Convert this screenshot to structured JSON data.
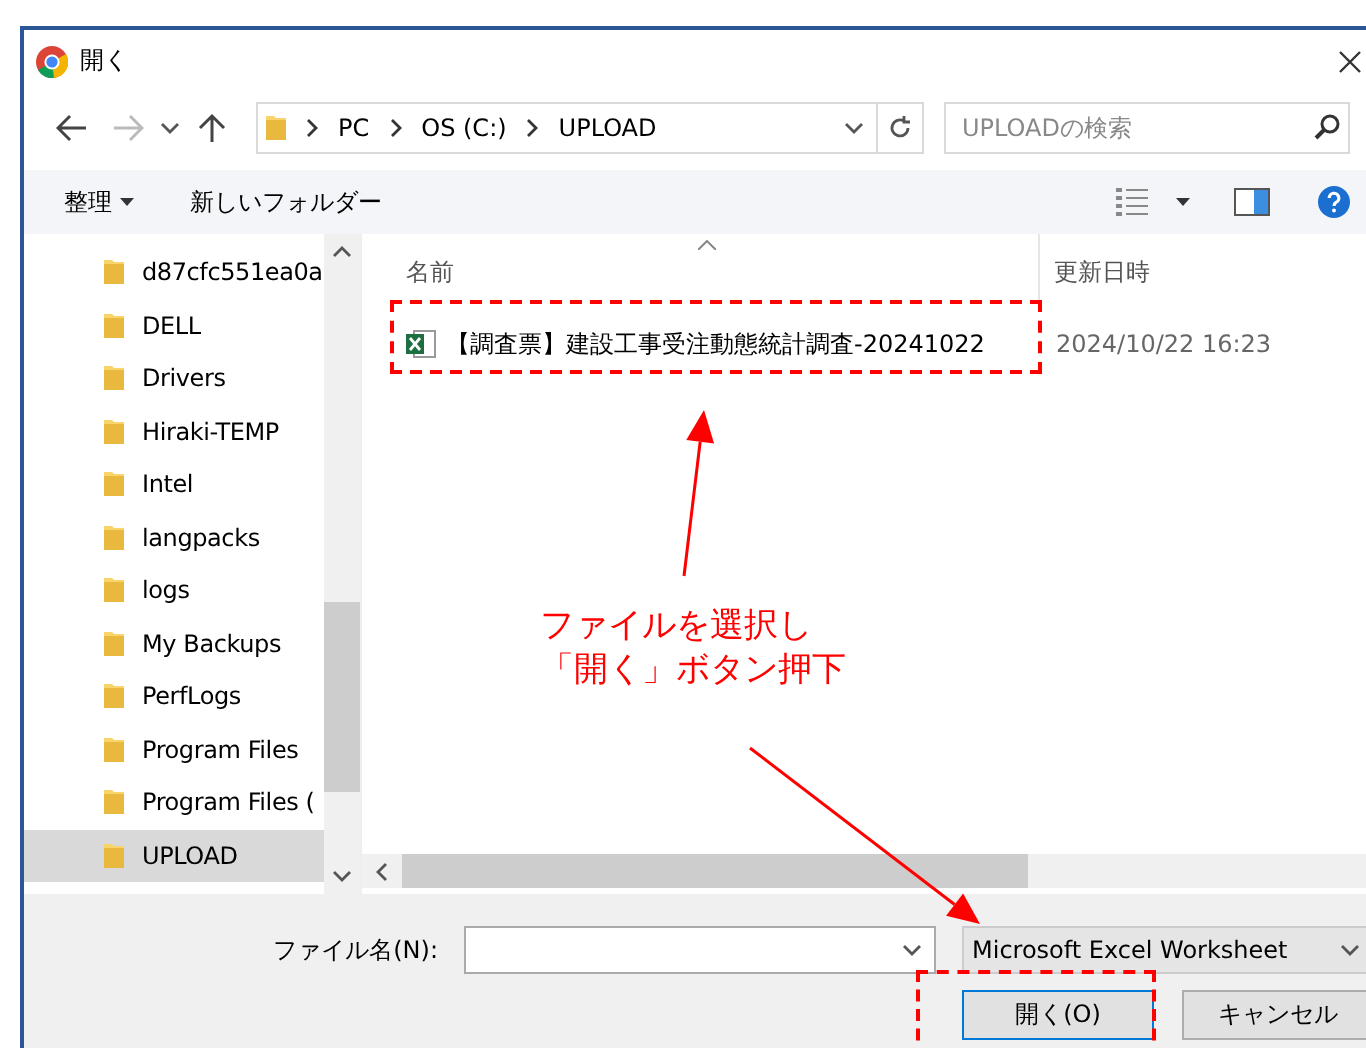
{
  "window": {
    "title": "開く"
  },
  "address": {
    "crumbs": [
      "PC",
      "OS (C:)",
      "UPLOAD"
    ]
  },
  "search": {
    "placeholder": "UPLOADの検索"
  },
  "toolbar": {
    "organize": "整理",
    "new_folder": "新しいフォルダー"
  },
  "sidebar": {
    "items": [
      {
        "label": "d87cfc551ea0a",
        "selected": false
      },
      {
        "label": "DELL",
        "selected": false
      },
      {
        "label": "Drivers",
        "selected": false
      },
      {
        "label": "Hiraki-TEMP",
        "selected": false
      },
      {
        "label": "Intel",
        "selected": false
      },
      {
        "label": "langpacks",
        "selected": false
      },
      {
        "label": "logs",
        "selected": false
      },
      {
        "label": "My Backups",
        "selected": false
      },
      {
        "label": "PerfLogs",
        "selected": false
      },
      {
        "label": "Program Files",
        "selected": false
      },
      {
        "label": "Program Files (",
        "selected": false
      },
      {
        "label": "UPLOAD",
        "selected": true
      }
    ]
  },
  "table": {
    "columns": [
      "名前",
      "更新日時"
    ],
    "rows": [
      {
        "name": "【調査票】建設工事受注動態統計調査-20241022",
        "modified": "2024/10/22 16:23"
      }
    ]
  },
  "footer": {
    "filename_label": "ファイル名(N):",
    "file_type": "Microsoft Excel Worksheet",
    "buttons": [
      {
        "label": "開く(O)",
        "kind": "primary"
      },
      {
        "label": "キャンセル",
        "kind": "secondary"
      }
    ]
  },
  "annotation": {
    "lines": [
      "ファイルを選択し",
      "「開く」ボタン押下"
    ]
  }
}
